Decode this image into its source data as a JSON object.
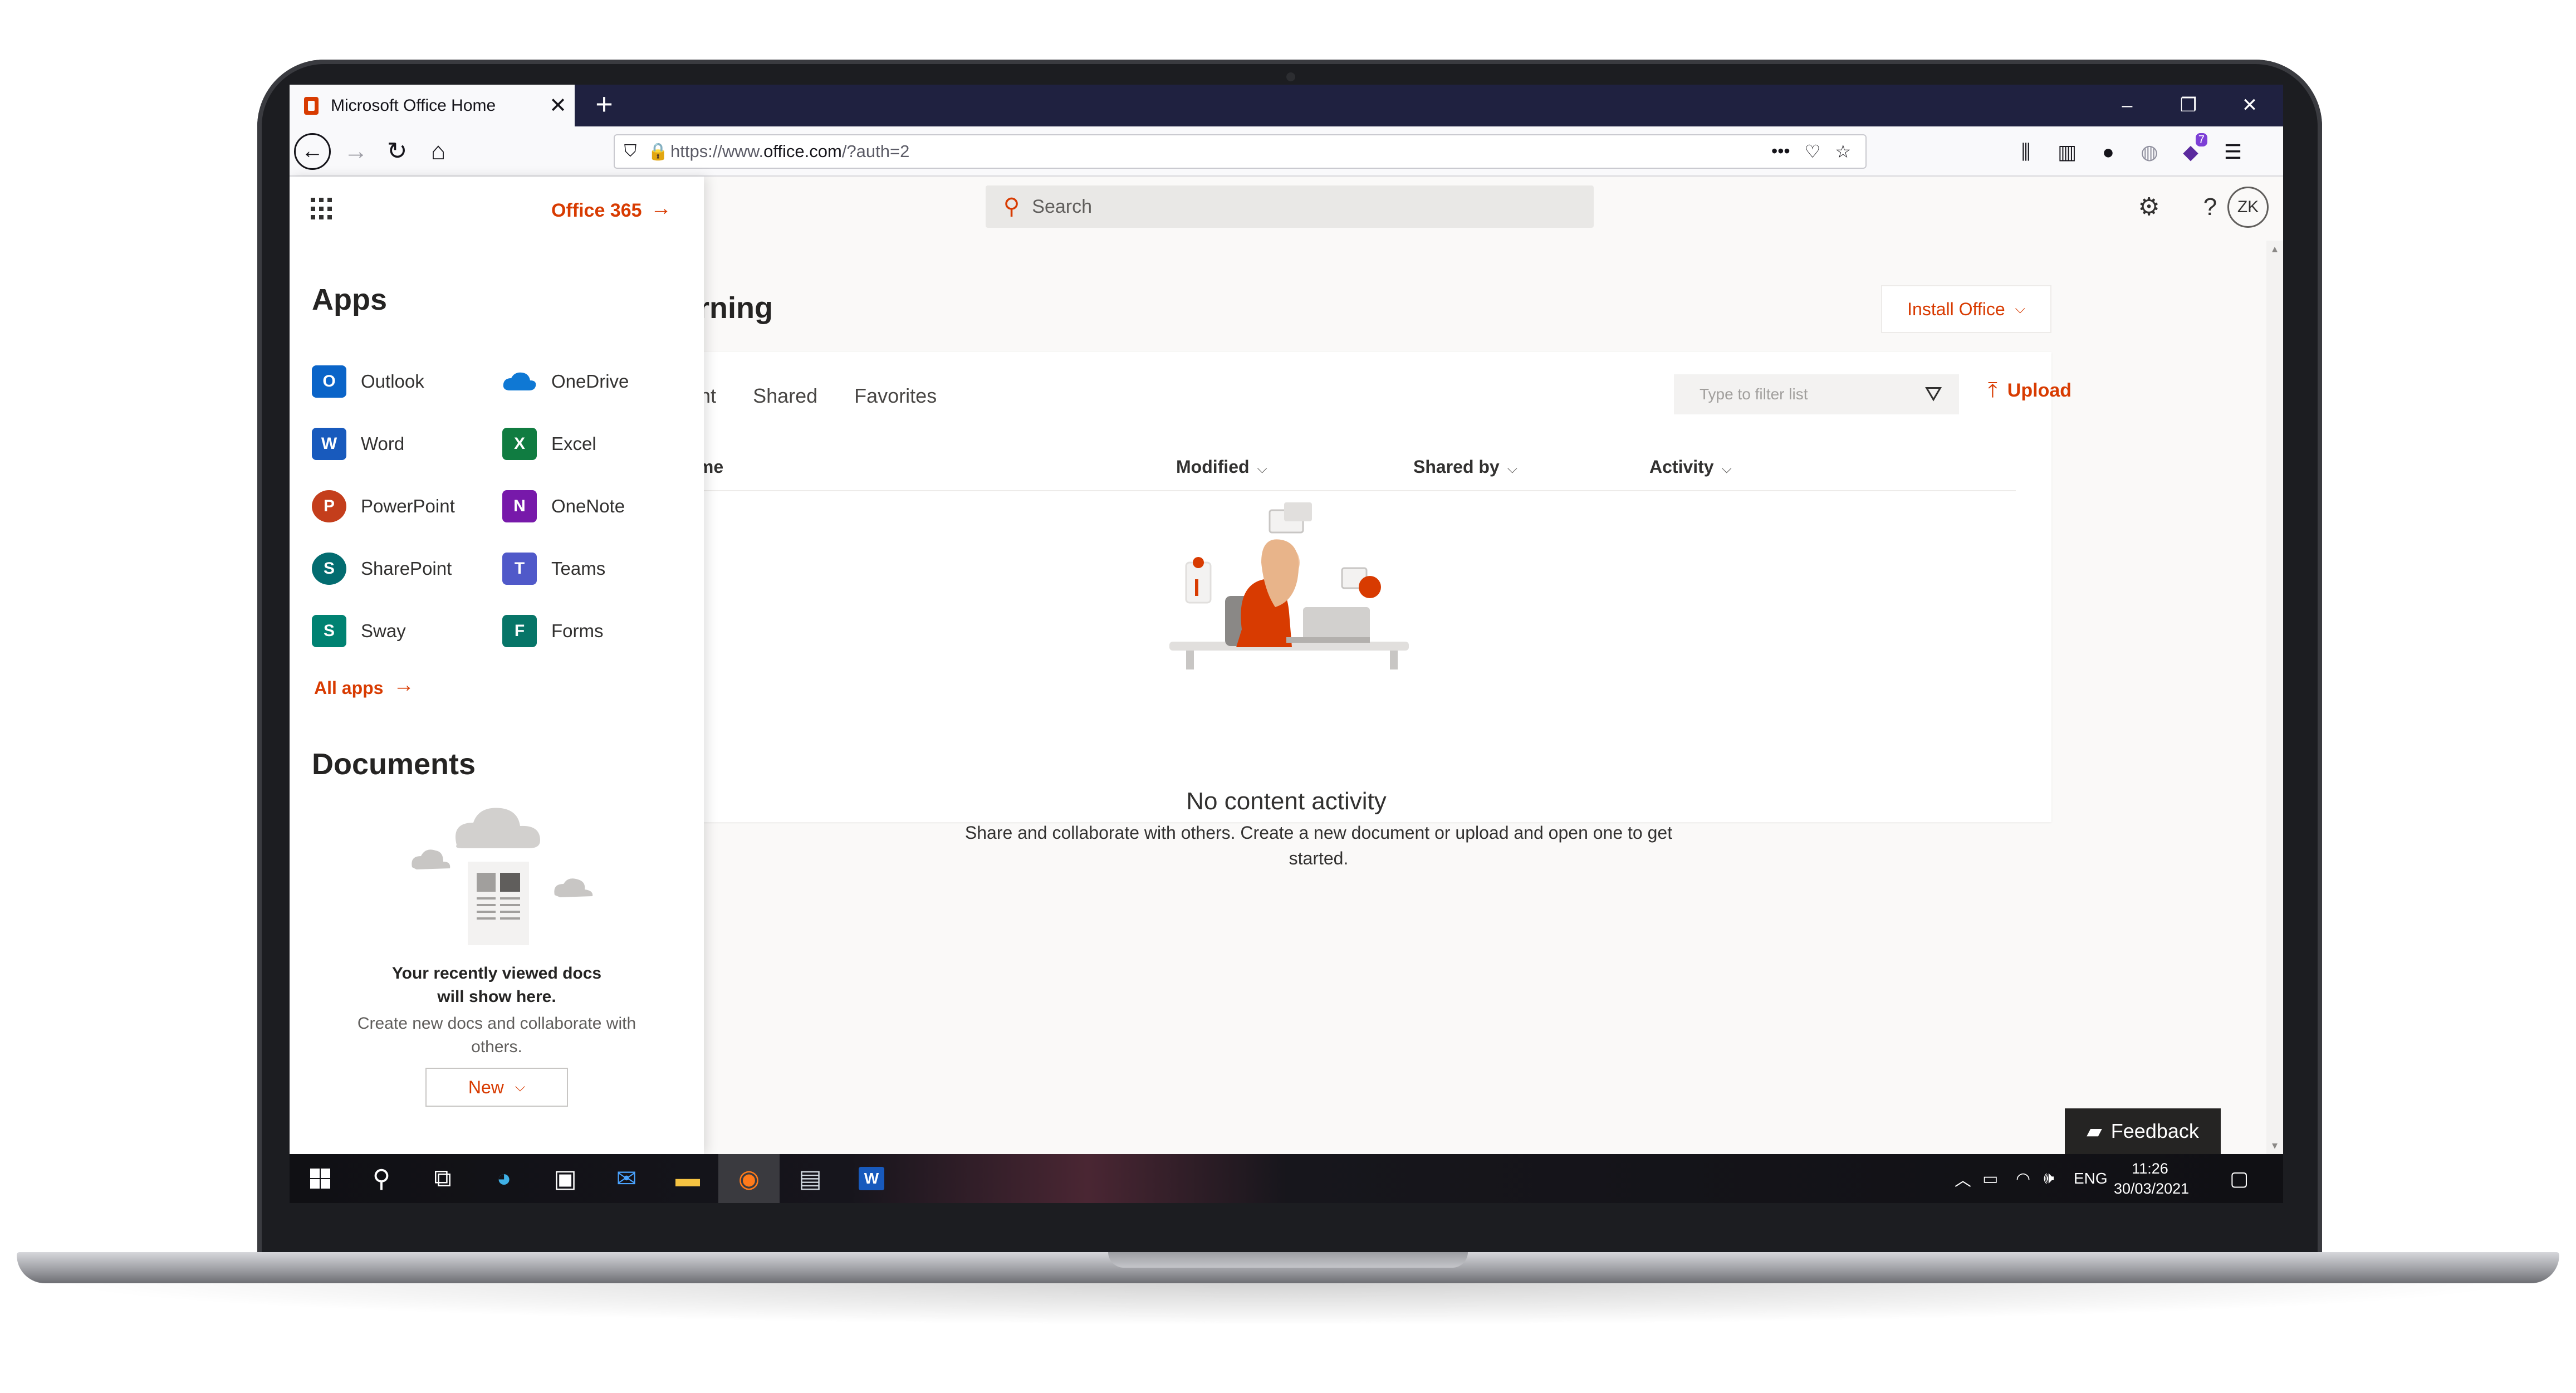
{
  "browser": {
    "tab_title": "Microsoft Office Home",
    "new_tab": "+",
    "url_prefix": "https://www.",
    "url_domain": "office.com",
    "url_suffix": "/?auth=2",
    "extension_badge": "7"
  },
  "office": {
    "search_placeholder": "Search",
    "avatar_initials": "ZK",
    "greeting": "orning",
    "install_label": "Install Office",
    "tabs": [
      "recent",
      "Shared",
      "Favorites"
    ],
    "filter_placeholder": "Type to filter list",
    "upload_label": "Upload",
    "columns": {
      "name": "Name",
      "modified": "Modified",
      "shared_by": "Shared by",
      "activity": "Activity"
    },
    "empty_title": "No content activity",
    "empty_text": "Share and collaborate with others. Create a new document or upload and open one to get started.",
    "feedback_label": "Feedback"
  },
  "panel": {
    "office365_label": "Office 365",
    "apps_heading": "Apps",
    "apps": [
      {
        "label": "Outlook",
        "icon": "outlook-icon",
        "color": "#0a64c8",
        "letter": "O"
      },
      {
        "label": "OneDrive",
        "icon": "onedrive-icon",
        "color": "#0f78d4",
        "letter": ""
      },
      {
        "label": "Word",
        "icon": "word-icon",
        "color": "#185abd",
        "letter": "W"
      },
      {
        "label": "Excel",
        "icon": "excel-icon",
        "color": "#107c41",
        "letter": "X"
      },
      {
        "label": "PowerPoint",
        "icon": "powerpoint-icon",
        "color": "#c43e1c",
        "letter": "P"
      },
      {
        "label": "OneNote",
        "icon": "onenote-icon",
        "color": "#7719aa",
        "letter": "N"
      },
      {
        "label": "SharePoint",
        "icon": "sharepoint-icon",
        "color": "#036c70",
        "letter": "S"
      },
      {
        "label": "Teams",
        "icon": "teams-icon",
        "color": "#5059c9",
        "letter": "T"
      },
      {
        "label": "Sway",
        "icon": "sway-icon",
        "color": "#008272",
        "letter": "S"
      },
      {
        "label": "Forms",
        "icon": "forms-icon",
        "color": "#077568",
        "letter": "F"
      }
    ],
    "all_apps": "All apps",
    "documents_heading": "Documents",
    "docs_bold_1": "Your recently viewed docs",
    "docs_bold_2": "will show here.",
    "docs_sub": "Create new docs and collaborate with others.",
    "new_label": "New"
  },
  "taskbar": {
    "language": "ENG",
    "time": "11:26",
    "date": "30/03/2021"
  },
  "colors": {
    "accent": "#d83b01",
    "tab_strip": "#1f2140"
  }
}
